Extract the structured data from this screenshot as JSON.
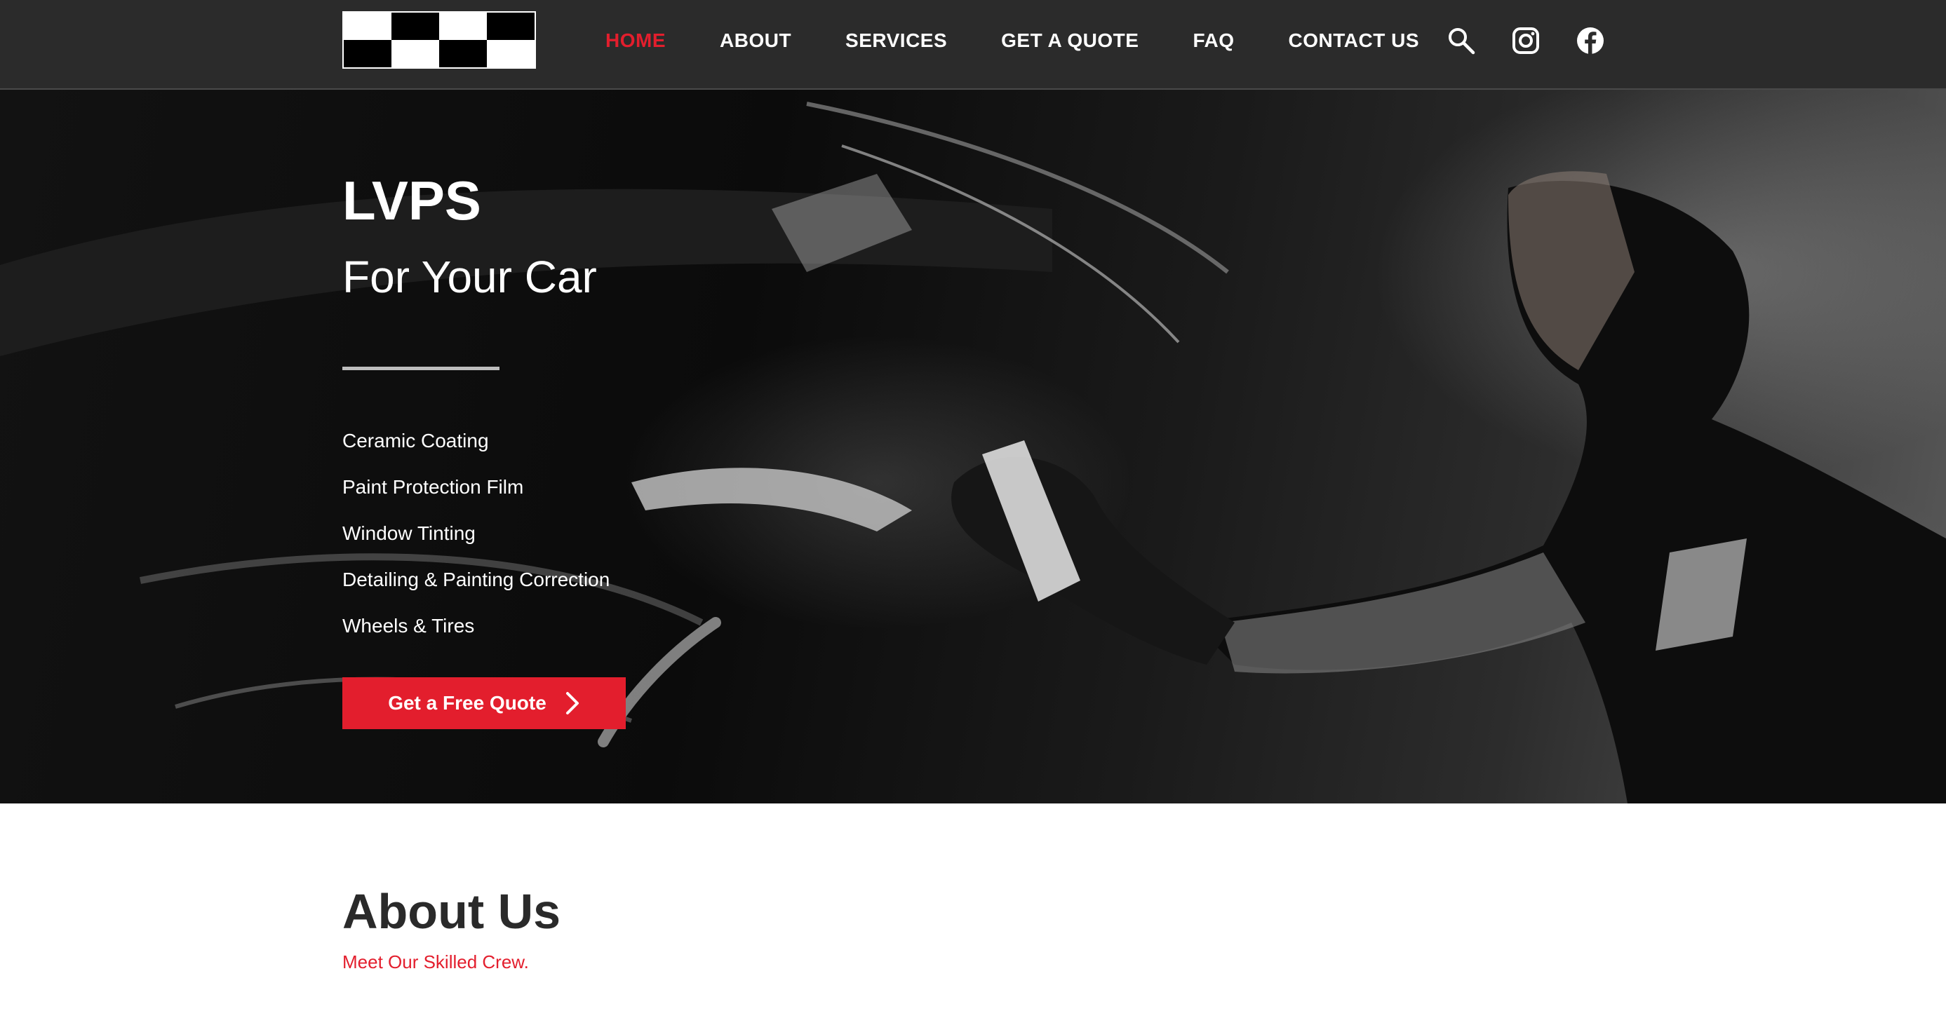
{
  "header": {
    "nav": [
      {
        "label": "HOME",
        "active": true
      },
      {
        "label": "ABOUT",
        "active": false
      },
      {
        "label": "SERVICES",
        "active": false
      },
      {
        "label": "GET A QUOTE",
        "active": false
      },
      {
        "label": "FAQ",
        "active": false
      },
      {
        "label": "CONTACT US",
        "active": false
      }
    ],
    "icons": [
      "search-icon",
      "instagram-icon",
      "facebook-icon"
    ]
  },
  "hero": {
    "title": "LVPS",
    "subtitle": "For Your Car",
    "services": [
      "Ceramic Coating",
      "Paint Protection Film",
      "Window Tinting",
      "Detailing & Painting Correction",
      "Wheels & Tires"
    ],
    "cta_label": "Get a Free Quote"
  },
  "about": {
    "title": "About Us",
    "tagline": "Meet Our Skilled Crew."
  },
  "colors": {
    "accent": "#e31e2d",
    "header_bg": "#2b2b2b",
    "text_dark": "#2a2a2a"
  }
}
